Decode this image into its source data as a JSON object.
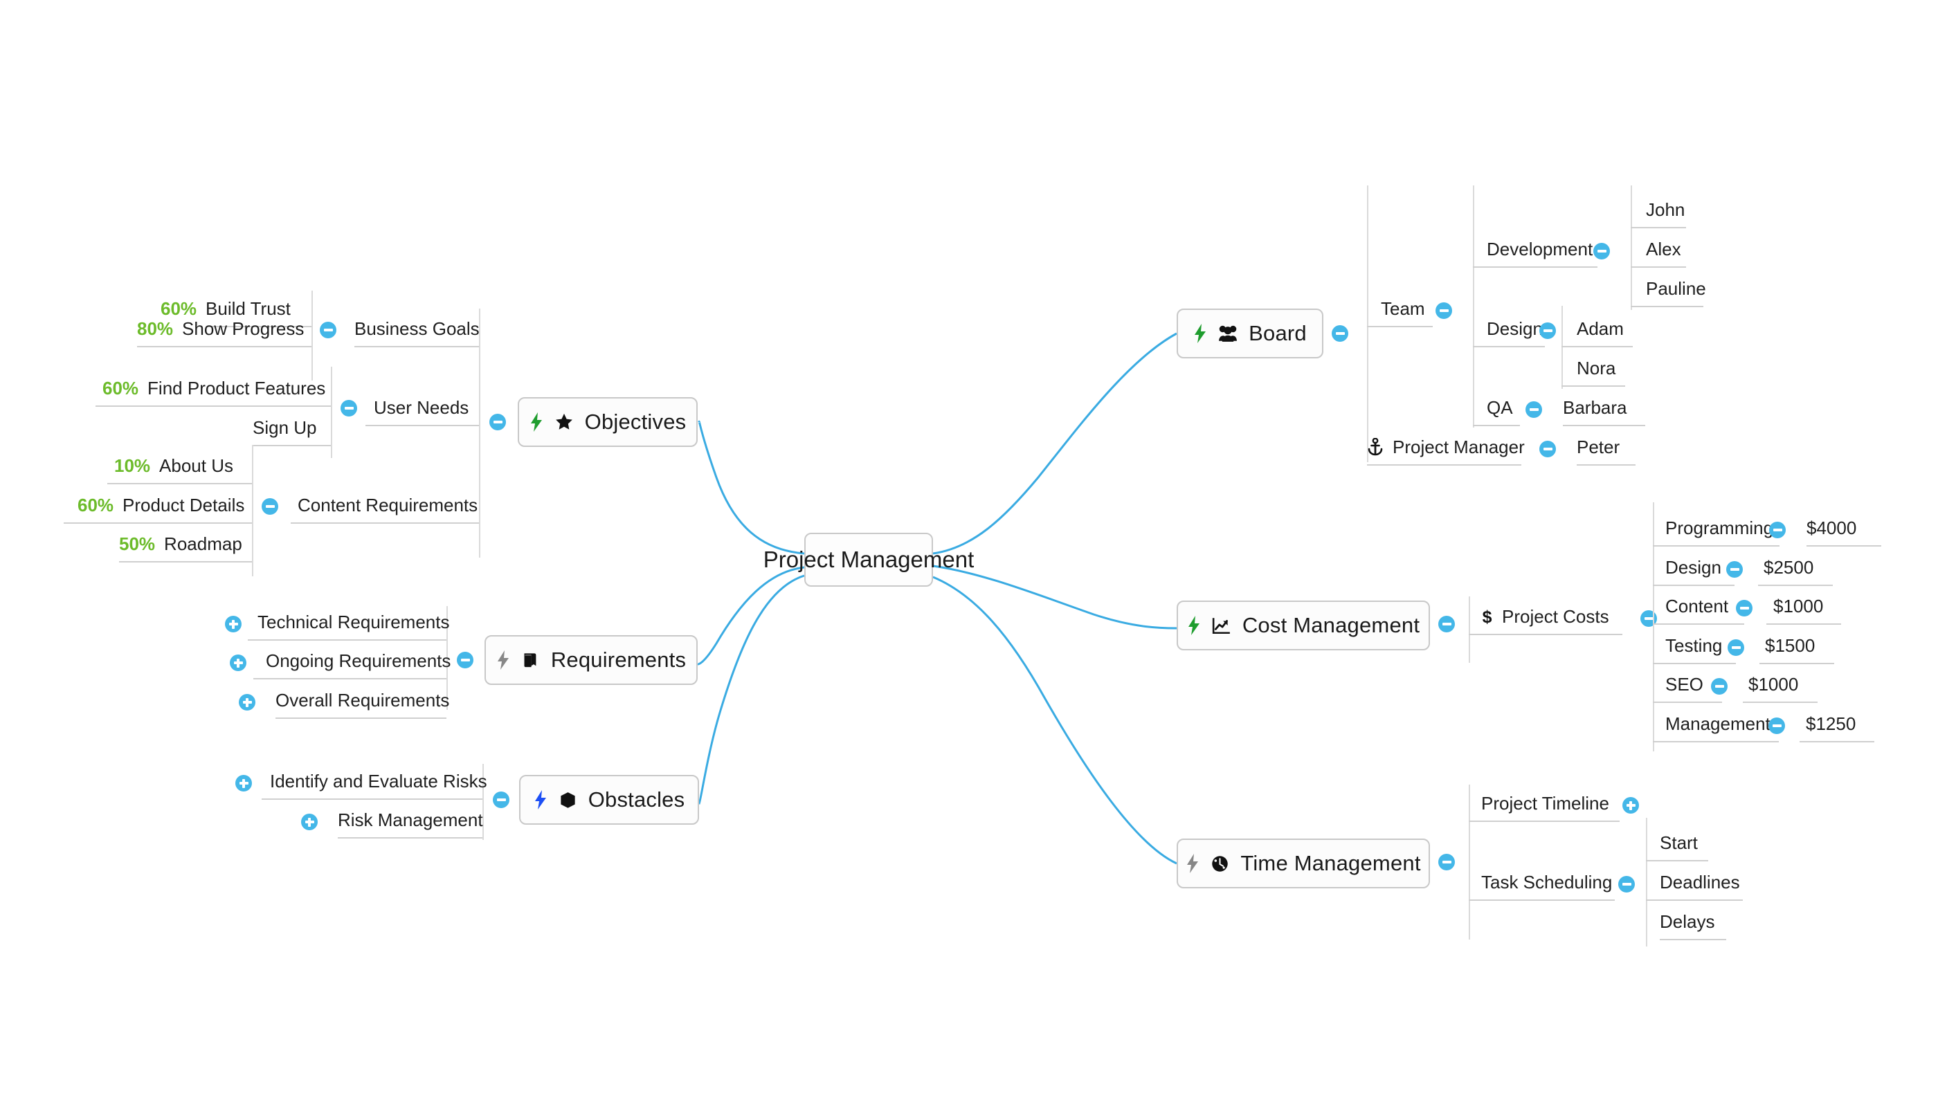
{
  "root": {
    "label": "Project Management"
  },
  "colors": {
    "connector": "#3aabe2",
    "toggle": "#44b7e8",
    "progress": "#6cbb2a",
    "node_border": "#c8c8c8",
    "rule": "#cfcfcf",
    "text": "#1f1f1f",
    "bolt_green": "#1f9d2e",
    "bolt_gray": "#878787",
    "bolt_blue": "#1d4ff5"
  },
  "branches": {
    "objectives": {
      "label": "Objectives",
      "icons": [
        "bolt-green-icon",
        "star-icon"
      ],
      "toggle": "minus",
      "children": [
        {
          "label": "Business Goals",
          "toggle": "minus",
          "children": [
            {
              "label": "Build Trust",
              "progress": "60%"
            },
            {
              "label": "Show Progress",
              "progress": "80%"
            }
          ]
        },
        {
          "label": "User Needs",
          "toggle": "minus",
          "children": [
            {
              "label": "Find Product Features",
              "progress": "60%"
            },
            {
              "label": "Sign Up",
              "progress": ""
            }
          ]
        },
        {
          "label": "Content Requirements",
          "toggle": "minus",
          "children": [
            {
              "label": "About Us",
              "progress": "10%"
            },
            {
              "label": "Product Details",
              "progress": "60%"
            },
            {
              "label": "Roadmap",
              "progress": "50%"
            }
          ]
        }
      ]
    },
    "requirements": {
      "label": "Requirements",
      "icons": [
        "bolt-gray-icon",
        "book-icon"
      ],
      "toggle": "minus",
      "children": [
        {
          "label": "Technical Requirements",
          "toggle": "plus"
        },
        {
          "label": "Ongoing Requirements",
          "toggle": "plus"
        },
        {
          "label": "Overall Requirements",
          "toggle": "plus"
        }
      ]
    },
    "obstacles": {
      "label": "Obstacles",
      "icons": [
        "bolt-blue-icon",
        "cube-icon"
      ],
      "toggle": "minus",
      "children": [
        {
          "label": "Identify and Evaluate Risks",
          "toggle": "plus"
        },
        {
          "label": "Risk Management",
          "toggle": "plus"
        }
      ]
    },
    "board": {
      "label": "Board",
      "icons": [
        "bolt-green-icon",
        "users-icon"
      ],
      "toggle": "minus",
      "children": [
        {
          "label": "Team",
          "toggle": "minus",
          "children": [
            {
              "label": "Development",
              "toggle": "minus",
              "children": [
                {
                  "label": "John"
                },
                {
                  "label": "Alex"
                },
                {
                  "label": "Pauline"
                }
              ]
            },
            {
              "label": "Design",
              "toggle": "minus",
              "children": [
                {
                  "label": "Adam"
                },
                {
                  "label": "Nora"
                }
              ]
            },
            {
              "label": "QA",
              "toggle": "minus",
              "children": [
                {
                  "label": "Barbara"
                }
              ]
            }
          ]
        },
        {
          "label": "Project Manager",
          "icon": "anchor-icon",
          "toggle": "minus",
          "children": [
            {
              "label": "Peter"
            }
          ]
        }
      ]
    },
    "cost_management": {
      "label": "Cost Management",
      "icons": [
        "bolt-green-icon",
        "chart-line-icon"
      ],
      "toggle": "minus",
      "children": [
        {
          "label": "Project Costs",
          "icon": "dollar-icon",
          "toggle": "minus",
          "children": [
            {
              "label": "Programming",
              "toggle": "minus",
              "amount": "$4000"
            },
            {
              "label": "Design",
              "toggle": "minus",
              "amount": "$2500"
            },
            {
              "label": "Content",
              "toggle": "minus",
              "amount": "$1000"
            },
            {
              "label": "Testing",
              "toggle": "minus",
              "amount": "$1500"
            },
            {
              "label": "SEO",
              "toggle": "minus",
              "amount": "$1000"
            },
            {
              "label": "Management",
              "toggle": "minus",
              "amount": "$1250"
            }
          ]
        }
      ]
    },
    "time_management": {
      "label": "Time Management",
      "icons": [
        "bolt-gray-icon",
        "globe-icon"
      ],
      "toggle": "minus",
      "children": [
        {
          "label": "Project Timeline",
          "toggle": "plus"
        },
        {
          "label": "Task Scheduling",
          "toggle": "minus",
          "children": [
            {
              "label": "Start"
            },
            {
              "label": "Deadlines"
            },
            {
              "label": "Delays"
            }
          ]
        }
      ]
    }
  }
}
